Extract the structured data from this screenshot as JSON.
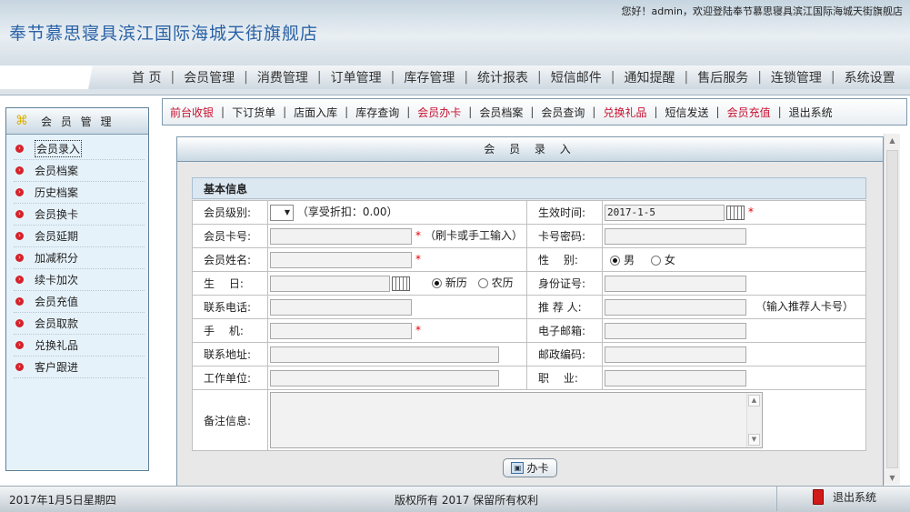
{
  "header": {
    "title": "奉节慕思寝具滨江国际海城天街旗舰店",
    "welcome": "您好！admin，欢迎登陆奉节慕思寝具滨江国际海城天街旗舰店"
  },
  "main_nav": [
    "首 页",
    "会员管理",
    "消费管理",
    "订单管理",
    "库存管理",
    "统计报表",
    "短信邮件",
    "通知提醒",
    "售后服务",
    "连锁管理",
    "系统设置"
  ],
  "sidebar": {
    "title": "会 员 管 理",
    "items": [
      "会员录入",
      "会员档案",
      "历史档案",
      "会员换卡",
      "会员延期",
      "加减积分",
      "续卡加次",
      "会员充值",
      "会员取款",
      "兑换礼品",
      "客户跟进"
    ]
  },
  "sub_nav": [
    {
      "label": "前台收银",
      "red": true
    },
    {
      "label": "下订货单",
      "red": false
    },
    {
      "label": "店面入库",
      "red": false
    },
    {
      "label": "库存查询",
      "red": false
    },
    {
      "label": "会员办卡",
      "red": true
    },
    {
      "label": "会员档案",
      "red": false
    },
    {
      "label": "会员查询",
      "red": false
    },
    {
      "label": "兑换礼品",
      "red": true
    },
    {
      "label": "短信发送",
      "red": false
    },
    {
      "label": "会员充值",
      "red": true
    },
    {
      "label": "退出系统",
      "red": false
    }
  ],
  "panel": {
    "title": "会 员 录 入",
    "section": "基本信息",
    "labels": {
      "level": "会员级别:",
      "effective": "生效时间:",
      "card_no": "会员卡号:",
      "card_pwd": "卡号密码:",
      "name": "会员姓名:",
      "gender": "性　 别:",
      "birthday": "生　 日:",
      "id_no": "身份证号:",
      "phone": "联系电话:",
      "referrer": "推 荐 人:",
      "mobile": "手　 机:",
      "email": "电子邮箱:",
      "address": "联系地址:",
      "postcode": "邮政编码:",
      "employer": "工作单位:",
      "job": "职　 业:",
      "remarks": "备注信息:"
    },
    "discount_hint": "（享受折扣：0.00）",
    "effective_value": "2017-1-5",
    "card_hint": "（刷卡或手工输入）",
    "referrer_hint": "（输入推荐人卡号）",
    "required_mark": "*",
    "gender_options": [
      "男",
      "女"
    ],
    "calendar_options": [
      "新历",
      "农历"
    ],
    "submit": "办卡"
  },
  "footer": {
    "date": "2017年1月5日星期四",
    "copyright": "版权所有 2017 保留所有权利",
    "exit": "退出系统"
  },
  "colors": {
    "accent_red": "#c8102e",
    "title_blue": "#2b62a6"
  }
}
